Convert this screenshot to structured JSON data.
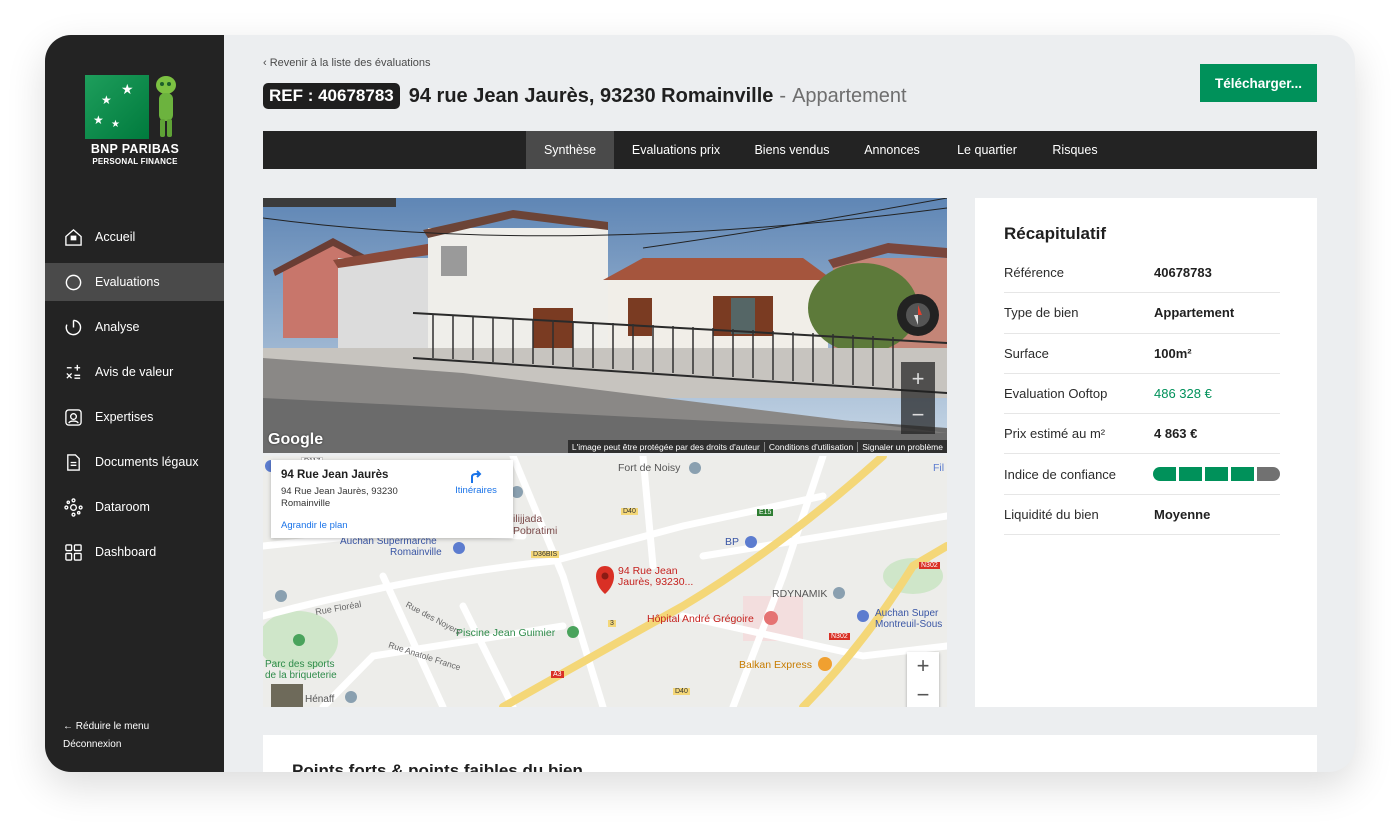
{
  "brand": {
    "line1": "BNP PARIBAS",
    "line2": "PERSONAL FINANCE"
  },
  "sidebar": {
    "items": [
      {
        "label": "Accueil",
        "icon": "home-icon",
        "active": false
      },
      {
        "label": "Evaluations",
        "icon": "search-icon",
        "active": true
      },
      {
        "label": "Analyse",
        "icon": "chart-ring-icon",
        "active": false
      },
      {
        "label": "Avis de valeur",
        "icon": "calculator-icon",
        "active": false
      },
      {
        "label": "Expertises",
        "icon": "expert-icon",
        "active": false
      },
      {
        "label": "Documents légaux",
        "icon": "document-icon",
        "active": false
      },
      {
        "label": "Dataroom",
        "icon": "network-icon",
        "active": false
      },
      {
        "label": "Dashboard",
        "icon": "dashboard-icon",
        "active": false
      }
    ],
    "reduce_label": "Réduire le menu",
    "logout_label": "Déconnexion"
  },
  "header": {
    "back_label": "Revenir à la liste des évaluations",
    "ref_badge": "REF : 40678783",
    "address": "94 rue Jean Jaurès, 93230 Romainville",
    "separator": "-",
    "property_type": "Appartement",
    "download_label": "Télécharger..."
  },
  "tabs": [
    {
      "label": "Synthèse",
      "active": true
    },
    {
      "label": "Evaluations prix",
      "active": false
    },
    {
      "label": "Biens vendus",
      "active": false
    },
    {
      "label": "Annonces",
      "active": false
    },
    {
      "label": "Le quartier",
      "active": false
    },
    {
      "label": "Risques",
      "active": false
    }
  ],
  "streetview": {
    "provider": "Google",
    "footer": [
      "L'image peut être protégée par des droits d'auteur",
      "Conditions d'utilisation",
      "Signaler un problème"
    ],
    "zoom_in": "+",
    "zoom_out": "−"
  },
  "map": {
    "card_title": "94 Rue Jean Jaurès",
    "card_address": "94 Rue Jean Jaurès, 93230 Romainville",
    "card_link": "Agrandir le plan",
    "directions_label": "Itinéraires",
    "pin_label_1": "94 Rue Jean",
    "pin_label_2": "Jaurès, 93230...",
    "labels": {
      "fort": "Fort de Noisy",
      "lidl": "Lidl",
      "fil": "Fil",
      "ilijjada1": "ilijjada",
      "ilijjada2": "Pobratimi",
      "auchan": "Auchan Supermarché",
      "romainville": "Romainville",
      "bp": "BP",
      "rdynamik": "RDYNAMIK",
      "hopital": "Hôpital André Grégoire",
      "piscine": "Piscine Jean Guimier",
      "auchan2a": "Auchan Super",
      "auchan2b": "Montreuil-Sous",
      "balkan": "Balkan Express",
      "parc1": "Parc des sports",
      "parc2": "de la briqueterie",
      "henaff": "Hénaff",
      "florea": "Rue Floréal",
      "noyers": "Rue des Noyers",
      "anatole": "Rue Anatole France",
      "roads": [
        "D117",
        "D40",
        "E15",
        "D36BIS",
        "3",
        "A3",
        "D40",
        "N302",
        "N302",
        "D40"
      ]
    },
    "zoom_in": "+",
    "zoom_out": "−"
  },
  "recap": {
    "title": "Récapitulatif",
    "rows": [
      {
        "label": "Référence",
        "value": "40678783"
      },
      {
        "label": "Type de bien",
        "value": "Appartement"
      },
      {
        "label": "Surface",
        "value": "100m²"
      },
      {
        "label": "Evaluation Ooftop",
        "value": "486 328 €"
      },
      {
        "label": "Prix estimé au m²",
        "value": "4 863 €"
      },
      {
        "label": "Indice de confiance",
        "value": ""
      },
      {
        "label": "Liquidité du bien",
        "value": "Moyenne"
      }
    ],
    "confidence_level": 4,
    "confidence_max": 5
  },
  "bottom": {
    "title": "Points forts & points faibles du bien"
  },
  "colors": {
    "brand_green": "#00915a",
    "sidebar_bg": "#232323",
    "active_bg": "#4a4a4a"
  }
}
